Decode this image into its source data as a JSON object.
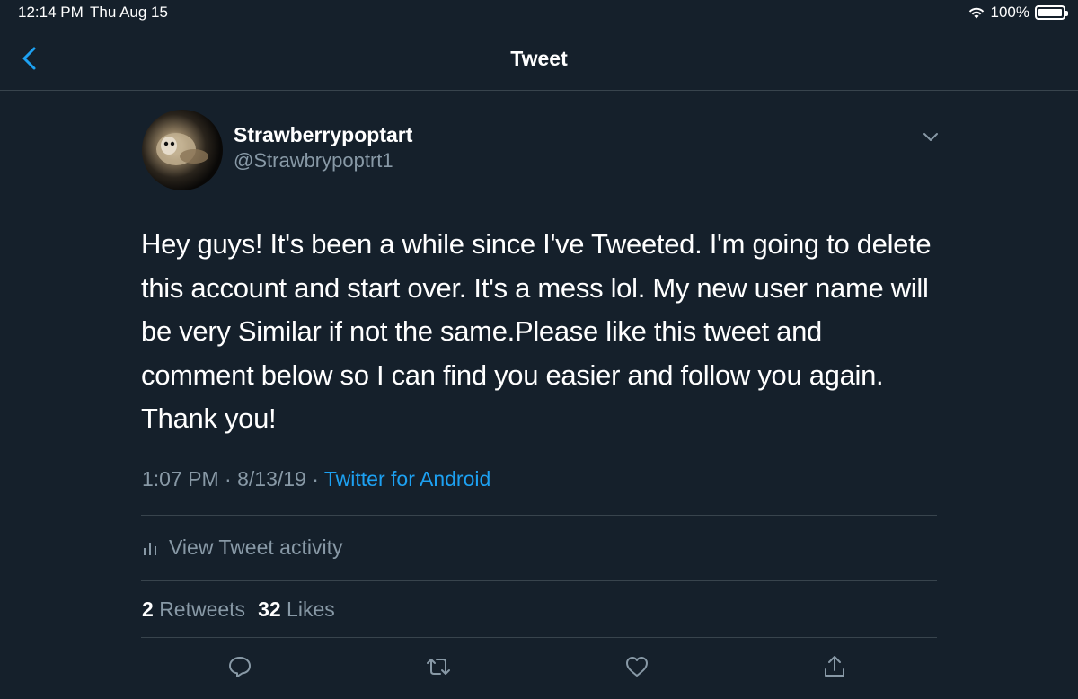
{
  "status_bar": {
    "time": "12:14 PM",
    "date": "Thu Aug 15",
    "battery": "100%"
  },
  "nav": {
    "title": "Tweet"
  },
  "tweet": {
    "display_name": "Strawberrypoptart",
    "handle": "@Strawbrypoptrt1",
    "text": "Hey guys! It's been a while since I've Tweeted. I'm going to delete this account and start over. It's a mess lol. My new user name will be very Similar if not the same.Please like this tweet and comment below so I can find you easier and follow you again. Thank you!",
    "time": "1:07 PM",
    "date": "8/13/19",
    "source": "Twitter for Android",
    "separator": "·",
    "activity_label": "View Tweet activity",
    "retweets_count": "2",
    "retweets_label": "Retweets",
    "likes_count": "32",
    "likes_label": "Likes"
  },
  "colors": {
    "background": "#15202b",
    "accent": "#1da1f2",
    "secondary_text": "#8899a6",
    "divider": "#38444d"
  },
  "icons": [
    "back-chevron-icon",
    "chevron-down-icon",
    "bar-chart-icon",
    "reply-icon",
    "retweet-icon",
    "like-icon",
    "share-icon",
    "wifi-icon",
    "battery-icon"
  ]
}
